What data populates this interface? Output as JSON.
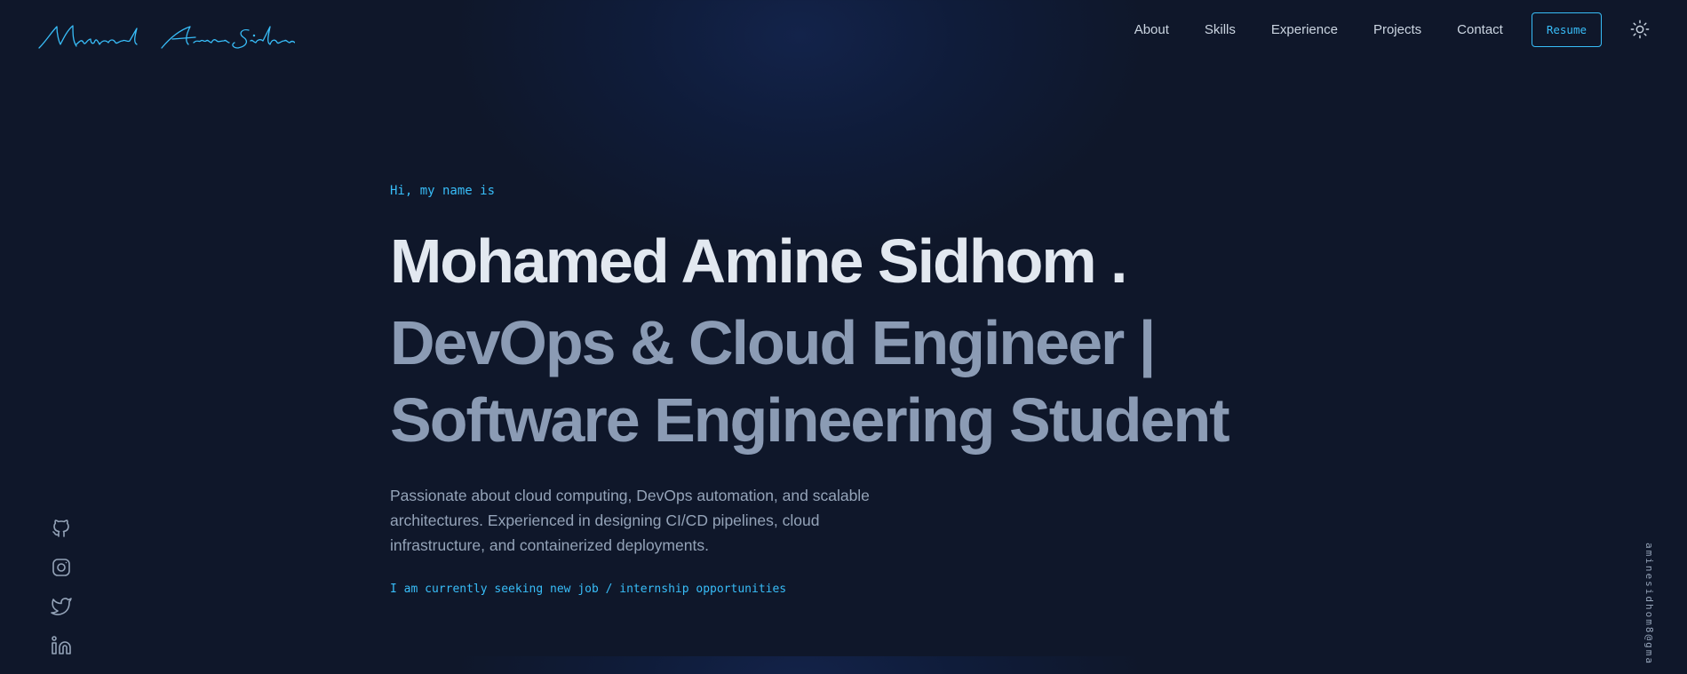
{
  "header": {
    "logo_text": "Mohamed Amine Sidhom",
    "nav": [
      {
        "label": "About"
      },
      {
        "label": "Skills"
      },
      {
        "label": "Experience"
      },
      {
        "label": "Projects"
      },
      {
        "label": "Contact"
      }
    ],
    "resume_label": "Resume",
    "theme_icon": "sun-icon"
  },
  "hero": {
    "intro": "Hi, my name is",
    "name": "Mohamed Amine Sidhom .",
    "role_line1": "DevOps & Cloud Engineer |",
    "role_line2": "Software Engineering Student",
    "description": "Passionate about cloud computing, DevOps automation, and scalable architectures. Experienced in designing CI/CD pipelines, cloud infrastructure, and containerized deployments.",
    "seeking": "I am currently seeking new job / internship opportunities"
  },
  "social": [
    "github-icon",
    "instagram-icon",
    "twitter-icon",
    "linkedin-icon"
  ],
  "email": "aminesidhom8@gma",
  "colors": {
    "background": "#0f172a",
    "accent": "#38bdf8",
    "heading": "#e2e8f0",
    "subheading": "#8b9bb4",
    "text": "#94a3b8"
  }
}
